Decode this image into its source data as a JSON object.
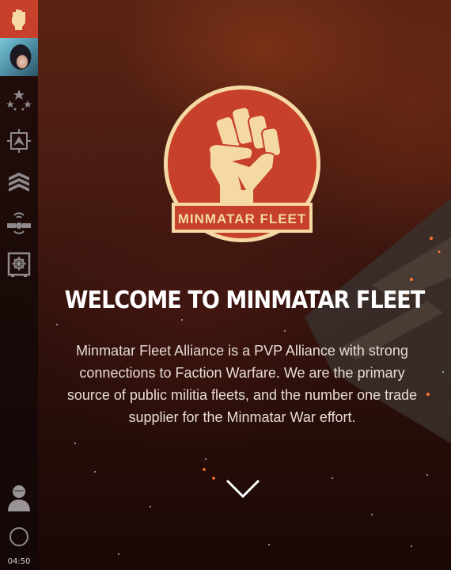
{
  "sidebar": {
    "items": [
      {
        "icon": "fist-icon",
        "active": true
      },
      {
        "icon": "character-portrait"
      },
      {
        "icon": "stars-icon"
      },
      {
        "icon": "chevron-insignia-icon"
      },
      {
        "icon": "rank-stripes-icon"
      },
      {
        "icon": "satellite-icon"
      },
      {
        "icon": "vault-icon"
      }
    ],
    "bottom": {
      "user_icon": "pilot-silhouette-icon",
      "status_icon": "status-ring-icon",
      "time": "04:50"
    }
  },
  "logo": {
    "banner_text": "MINMATAR FLEET",
    "colors": {
      "red": "#c6402a",
      "cream": "#f5d9a4"
    }
  },
  "hero": {
    "title": "WELCOME TO MINMATAR FLEET",
    "description": "Minmatar Fleet Alliance is a PVP Alliance with strong connections to Faction Warfare. We are the primary source of public militia fleets, and the number one trade supplier for the Minmatar War effort.",
    "scroll_icon": "chevron-down-icon"
  }
}
